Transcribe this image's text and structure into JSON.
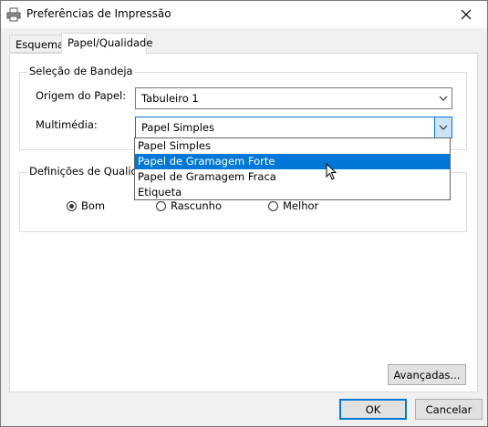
{
  "window": {
    "title": "Preferências de Impressão"
  },
  "tabs": [
    {
      "label": "Esquema",
      "active": false
    },
    {
      "label": "Papel/Qualidade",
      "active": true
    }
  ],
  "tray": {
    "group_label": "Seleção de Bandeja",
    "source_label": "Origem do Papel:",
    "source_value": "Tabuleiro 1",
    "media_label": "Multimédia:",
    "media_value": "Papel Simples"
  },
  "media_options": [
    "Papel Simples",
    "Papel de Gramagem Forte",
    "Papel de Gramagem Fraca",
    "Etiqueta"
  ],
  "media_highlighted_index": 1,
  "quality": {
    "group_label": "Definições de Qualidade",
    "options": [
      "Bom",
      "Rascunho",
      "Melhor"
    ],
    "selected": "Bom"
  },
  "buttons": {
    "advanced": "Avançadas...",
    "ok": "OK",
    "cancel": "Cancelar"
  },
  "colors": {
    "accent": "#0078d7",
    "selection_bg": "#0078d7"
  }
}
